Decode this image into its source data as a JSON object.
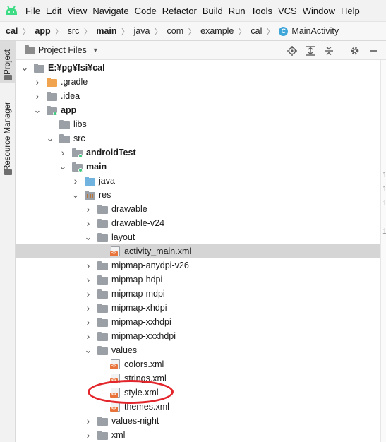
{
  "menubar": {
    "items": [
      "File",
      "Edit",
      "View",
      "Navigate",
      "Code",
      "Refactor",
      "Build",
      "Run",
      "Tools",
      "VCS",
      "Window",
      "Help"
    ]
  },
  "breadcrumb": {
    "items": [
      "cal",
      "app",
      "src",
      "main",
      "java",
      "com",
      "example",
      "cal"
    ],
    "bold_items": [
      "cal",
      "app",
      "main"
    ],
    "class_badge": "C",
    "current": "MainActivity"
  },
  "side_tabs": {
    "project": "Project",
    "resource_manager": "Resource Manager"
  },
  "panel": {
    "title": "Project Files",
    "tools": [
      "locate-icon",
      "expand-all-icon",
      "collapse-all-icon",
      "gear-icon",
      "minimize-icon"
    ]
  },
  "tree": [
    {
      "label": "E:¥pg¥fsi¥cal",
      "depth": 0,
      "arrow": "open",
      "icon": "folder-gray",
      "bold": true
    },
    {
      "label": ".gradle",
      "depth": 1,
      "arrow": "closed",
      "icon": "folder-orange"
    },
    {
      "label": ".idea",
      "depth": 1,
      "arrow": "closed",
      "icon": "folder-gray"
    },
    {
      "label": "app",
      "depth": 1,
      "arrow": "open",
      "icon": "folder-module",
      "bold": true
    },
    {
      "label": "libs",
      "depth": 2,
      "arrow": "none",
      "icon": "folder-gray"
    },
    {
      "label": "src",
      "depth": 2,
      "arrow": "open",
      "icon": "folder-gray"
    },
    {
      "label": "androidTest",
      "depth": 3,
      "arrow": "closed",
      "icon": "folder-module",
      "bold": true
    },
    {
      "label": "main",
      "depth": 3,
      "arrow": "open",
      "icon": "folder-module",
      "bold": true
    },
    {
      "label": "java",
      "depth": 4,
      "arrow": "closed",
      "icon": "folder-blue"
    },
    {
      "label": "res",
      "depth": 4,
      "arrow": "open",
      "icon": "folder-res"
    },
    {
      "label": "drawable",
      "depth": 5,
      "arrow": "closed",
      "icon": "folder-gray"
    },
    {
      "label": "drawable-v24",
      "depth": 5,
      "arrow": "closed",
      "icon": "folder-gray"
    },
    {
      "label": "layout",
      "depth": 5,
      "arrow": "open",
      "icon": "folder-gray"
    },
    {
      "label": "activity_main.xml",
      "depth": 6,
      "arrow": "none",
      "icon": "xml-file",
      "selected": true
    },
    {
      "label": "mipmap-anydpi-v26",
      "depth": 5,
      "arrow": "closed",
      "icon": "folder-gray"
    },
    {
      "label": "mipmap-hdpi",
      "depth": 5,
      "arrow": "closed",
      "icon": "folder-gray"
    },
    {
      "label": "mipmap-mdpi",
      "depth": 5,
      "arrow": "closed",
      "icon": "folder-gray"
    },
    {
      "label": "mipmap-xhdpi",
      "depth": 5,
      "arrow": "closed",
      "icon": "folder-gray"
    },
    {
      "label": "mipmap-xxhdpi",
      "depth": 5,
      "arrow": "closed",
      "icon": "folder-gray"
    },
    {
      "label": "mipmap-xxxhdpi",
      "depth": 5,
      "arrow": "closed",
      "icon": "folder-gray"
    },
    {
      "label": "values",
      "depth": 5,
      "arrow": "open",
      "icon": "folder-gray"
    },
    {
      "label": "colors.xml",
      "depth": 6,
      "arrow": "none",
      "icon": "xml-file"
    },
    {
      "label": "strings.xml",
      "depth": 6,
      "arrow": "none",
      "icon": "xml-file"
    },
    {
      "label": "style.xml",
      "depth": 6,
      "arrow": "none",
      "icon": "xml-file",
      "highlighted": true
    },
    {
      "label": "themes.xml",
      "depth": 6,
      "arrow": "none",
      "icon": "xml-file"
    },
    {
      "label": "values-night",
      "depth": 5,
      "arrow": "closed",
      "icon": "folder-gray"
    },
    {
      "label": "xml",
      "depth": 5,
      "arrow": "closed",
      "icon": "folder-gray"
    }
  ],
  "gutter_marks": [
    "1",
    "1",
    "1",
    "1"
  ],
  "colors": {
    "selection": "#d5d5d5",
    "annotation": "#e3262b",
    "module_dot": "#3cc87c",
    "android_green": "#3ddc84"
  }
}
